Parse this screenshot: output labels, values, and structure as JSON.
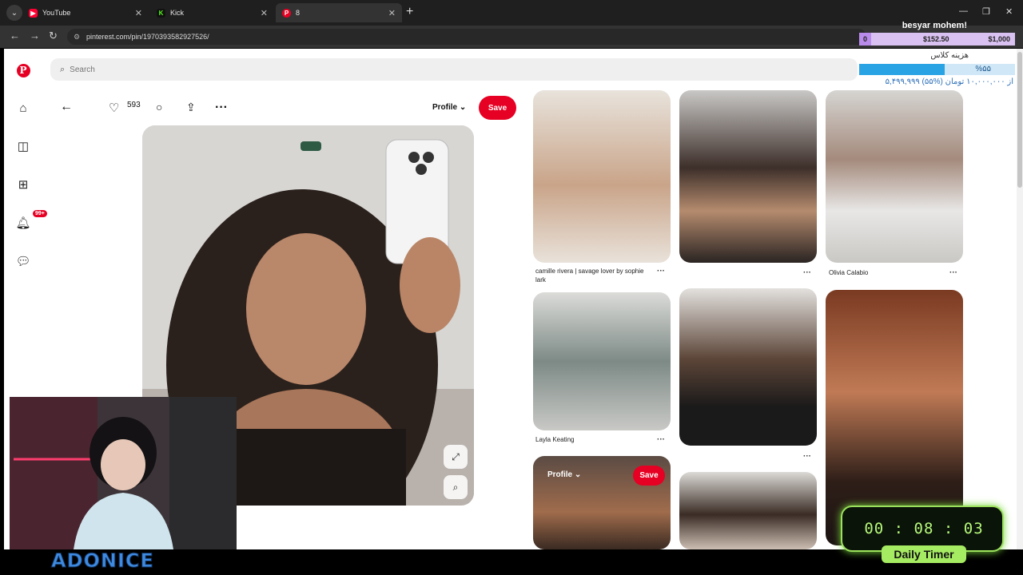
{
  "browser": {
    "tabs": [
      {
        "label": "YouTube",
        "color": "#ff0033",
        "glyph": "▶"
      },
      {
        "label": "Kick",
        "color": "#53fc18",
        "glyph": "K"
      },
      {
        "label": "8",
        "color": "#e60023",
        "glyph": "P"
      }
    ],
    "url": "pinterest.com/pin/1970393582927526/"
  },
  "pinterest": {
    "search_placeholder": "Search",
    "likes": "593",
    "board": "Profile",
    "save_label": "Save",
    "grid": [
      {
        "caption": "camille rivera | savage lover by sophie lark"
      },
      {
        "caption": ""
      },
      {
        "caption": "Olivia Calabio"
      },
      {
        "caption": "Layla Keating"
      },
      {
        "caption": ""
      },
      {
        "caption": ""
      },
      {
        "caption": ""
      },
      {
        "caption": ""
      }
    ],
    "overlay_profile": "Profile",
    "overlay_save": "Save",
    "notifications_badge": "99+"
  },
  "donation": {
    "name": "besyar mohem!",
    "start": "0",
    "current": "$152.50",
    "goal": "$1,000",
    "progress": 0.55,
    "title": "هزینه کلاس",
    "percent_label": "%۵۵",
    "amount_line": "۵,۴۹۹,۹۹۹ از ۱۰,۰۰۰,۰۰۰ تومان (%۵۵)"
  },
  "timer": {
    "time": "00 : 08 : 03",
    "label": "Daily Timer"
  },
  "stream": {
    "logo_text": "ADONICE"
  }
}
